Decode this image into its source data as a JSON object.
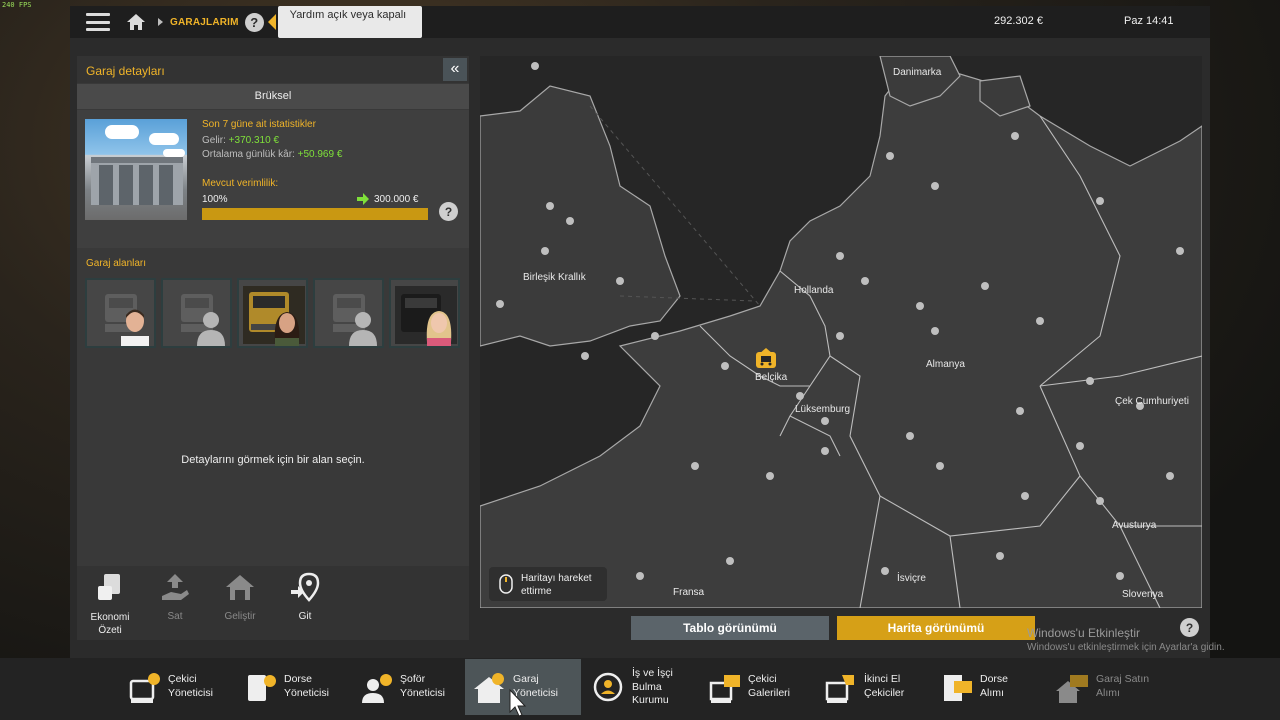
{
  "fps": "240 FPS",
  "topbar": {
    "breadcrumb": "GARAJLARIM",
    "help": "?",
    "tooltip": "Yardım açık veya kapalı",
    "money": "292.302 €",
    "clock": "Paz 14:41"
  },
  "left_panel": {
    "title": "Garaj detayları",
    "collapse_glyph": "«",
    "city": "Brüksel",
    "stats_title": "Son 7 güne ait istatistikler",
    "income_label": "Gelir: ",
    "income_value": "+370.310 €",
    "avg_label": "Ortalama günlük kâr: ",
    "avg_value": "+50.969 €",
    "efficiency_title": "Mevcut verimlilik:",
    "efficiency_percent": "100%",
    "efficiency_fill": 1.0,
    "efficiency_value": "300.000 €",
    "areas_title": "Garaj alanları",
    "slots": [
      {
        "truck": "placeholder",
        "driver": "male-driver"
      },
      {
        "truck": "placeholder",
        "driver": "silhouette"
      },
      {
        "truck": "gold-truck",
        "driver": "female-driver"
      },
      {
        "truck": "placeholder",
        "driver": "silhouette"
      },
      {
        "truck": "dark-truck",
        "driver": "blonde-driver"
      }
    ],
    "hint": "Detaylarını görmek için bir alan seçin.",
    "actions": [
      {
        "label": "Ekonomi Özeti",
        "icon": "economy-icon",
        "enabled": true
      },
      {
        "label": "Sat",
        "icon": "sell-icon",
        "enabled": false
      },
      {
        "label": "Geliştir",
        "icon": "upgrade-icon",
        "enabled": false
      },
      {
        "label": "Git",
        "icon": "goto-icon",
        "enabled": true
      }
    ]
  },
  "map": {
    "labels": {
      "denmark": "Danimarka",
      "uk": "Birleşik Krallık",
      "netherlands": "Hollanda",
      "belgium": "Belçika",
      "germany": "Almanya",
      "luxembourg": "Lüksemburg",
      "czech": "Çek Cumhuriyeti",
      "austria": "Avusturya",
      "switzerland": "İsviçre",
      "france": "Fransa",
      "slovenia": "Slovenya"
    },
    "move_hint": "Haritayı hareket ettirme"
  },
  "view": {
    "table": "Tablo görünümü",
    "map": "Harita görünümü"
  },
  "windows": {
    "line1": "Windows'u Etkinleştir",
    "line2": "Windows'u etkinleştirmek için Ayarlar'a gidin."
  },
  "dock": [
    {
      "label": "Çekici Yöneticisi",
      "icon": "truck-manager-icon"
    },
    {
      "label": "Dorse Yöneticisi",
      "icon": "trailer-manager-icon"
    },
    {
      "label": "Şoför Yöneticisi",
      "icon": "driver-manager-icon"
    },
    {
      "label": "Garaj Yöneticisi",
      "icon": "garage-manager-icon",
      "active": true
    },
    {
      "label": "İş ve İşçi Bulma Kurumu",
      "icon": "recruitment-icon"
    },
    {
      "label": "Çekici Galerileri",
      "icon": "truck-dealer-icon"
    },
    {
      "label": "İkinci El Çekiciler",
      "icon": "used-trucks-icon"
    },
    {
      "label": "Dorse Alımı",
      "icon": "trailer-purchase-icon"
    },
    {
      "label": "Garaj Satın Alımı",
      "icon": "garage-purchase-icon",
      "enabled": false
    }
  ],
  "colors": {
    "accent": "#f0b429",
    "positive": "#7fe03a",
    "panel": "#393939",
    "map_bg": "#262626"
  }
}
